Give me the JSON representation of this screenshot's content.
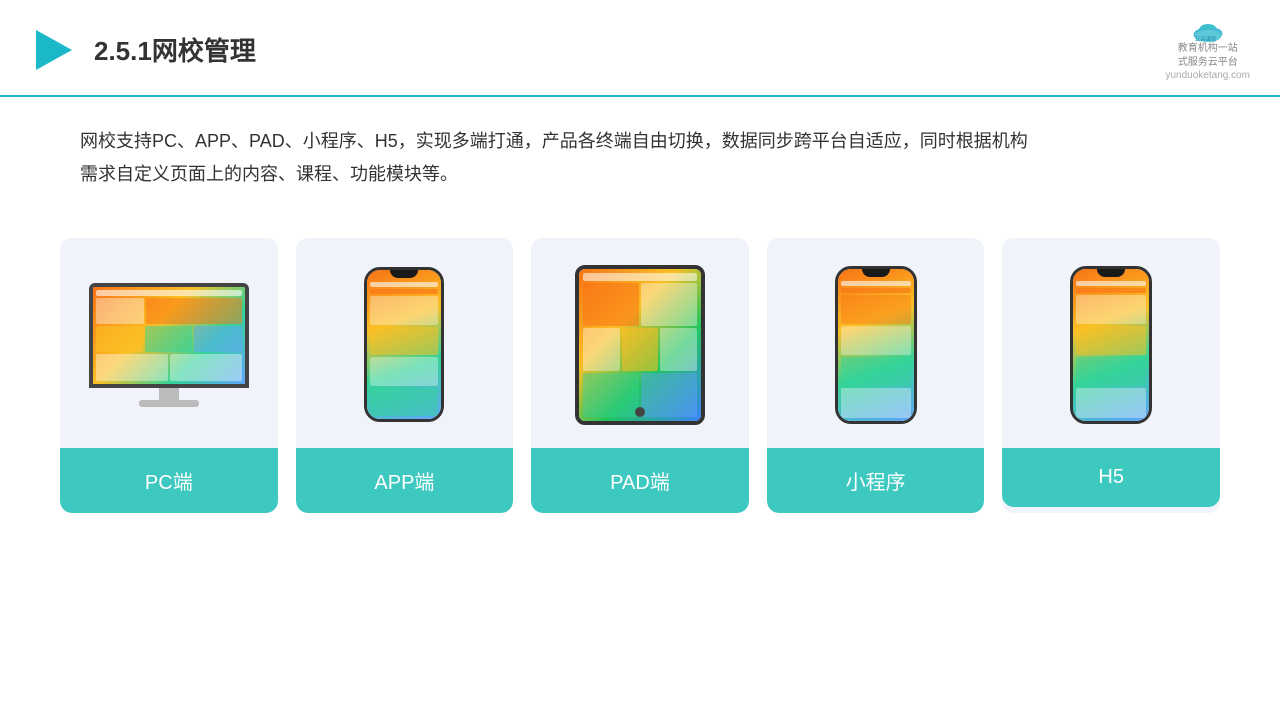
{
  "header": {
    "title": "2.5.1网校管理",
    "logo": {
      "name": "云朵课堂",
      "domain": "yunduoketang.com",
      "tagline": "教育机构一站\n式服务云平台"
    }
  },
  "description": {
    "text": "网校支持PC、APP、PAD、小程序、H5，实现多端打通，产品各终端自由切换，数据同步跨平台自适应，同时根据机构",
    "text2": "需求自定义页面上的内容、课程、功能模块等。"
  },
  "cards": [
    {
      "id": "pc",
      "label": "PC端"
    },
    {
      "id": "app",
      "label": "APP端"
    },
    {
      "id": "pad",
      "label": "PAD端"
    },
    {
      "id": "miniprogram",
      "label": "小程序"
    },
    {
      "id": "h5",
      "label": "H5"
    }
  ]
}
